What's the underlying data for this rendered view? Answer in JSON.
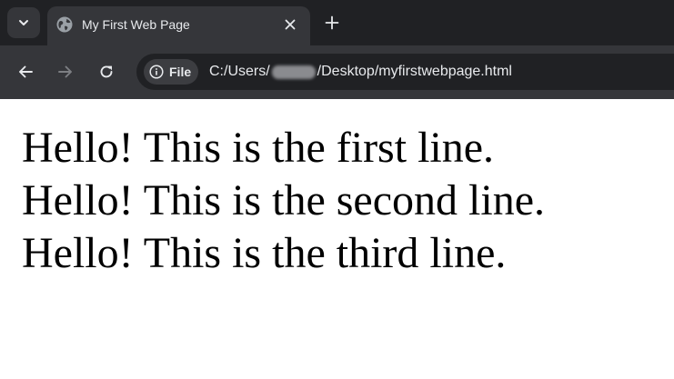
{
  "browser": {
    "tab": {
      "title": "My First Web Page"
    },
    "address_bar": {
      "chip_label": "File",
      "url_prefix": "C:/Users/",
      "url_suffix": "/Desktop/myfirstwebpage.html"
    }
  },
  "page": {
    "lines": [
      "Hello! This is the first line.",
      "Hello! This is the second line.",
      "Hello! This is the third line."
    ]
  },
  "colors": {
    "tabstrip_bg": "#202124",
    "toolbar_bg": "#35363a",
    "omnibox_bg": "#202124",
    "text_light": "#e8eaed",
    "page_bg": "#ffffff",
    "page_text": "#000000"
  },
  "icons": [
    "chevron-down-icon",
    "globe-icon",
    "close-icon",
    "plus-icon",
    "back-arrow-icon",
    "forward-arrow-icon",
    "reload-icon",
    "info-icon"
  ]
}
